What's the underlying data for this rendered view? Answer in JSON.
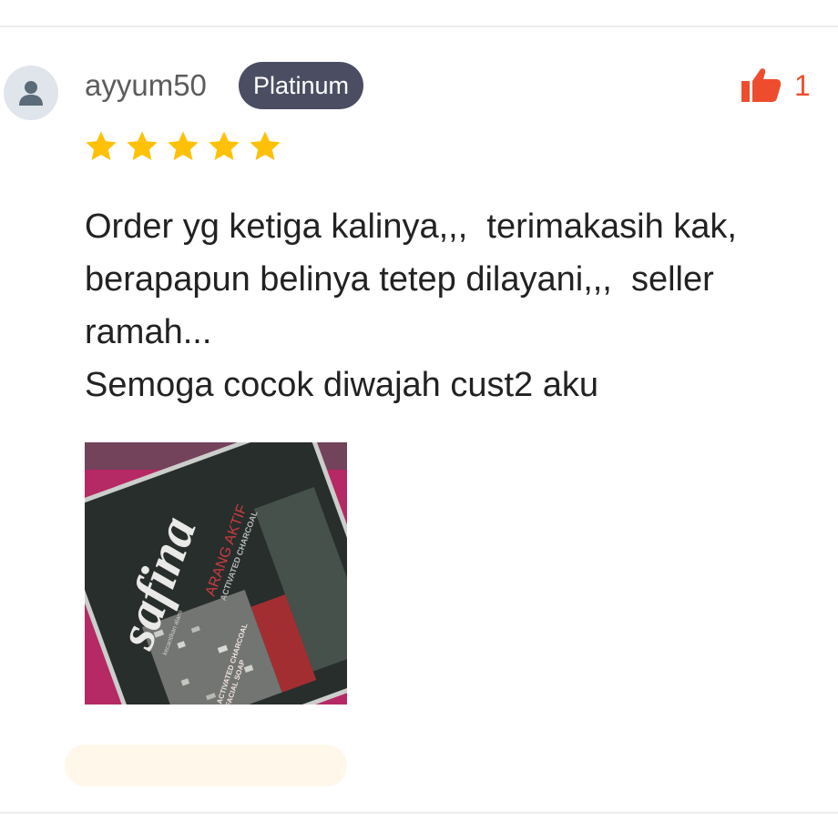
{
  "review": {
    "username": "ayyum50",
    "badge": "Platinum",
    "like_count": "1",
    "rating": 5,
    "text": "Order yg ketiga kalinya,,,  terimakasih kak,\nberapapun belinya tetep dilayani,,,  seller\nramah...\nSemoga cocok diwajah cust2 aku",
    "photo": {
      "brand": "safina",
      "title": "ARANG AKTIF",
      "subtitle": "ACTIVATED CHARCOAL",
      "small_text": "kecantikan alami",
      "band_line1": "ACTIVATED CHARCOAL",
      "band_line2": "FACIAL SOAP"
    }
  },
  "icons": {
    "avatar": "user-avatar-icon",
    "like": "thumbs-up-icon",
    "star": "star-icon"
  },
  "colors": {
    "accent": "#ee4d2d",
    "star": "#ffc107",
    "badge_bg": "#4b4d63",
    "reply_bar": "#fff8ea"
  }
}
